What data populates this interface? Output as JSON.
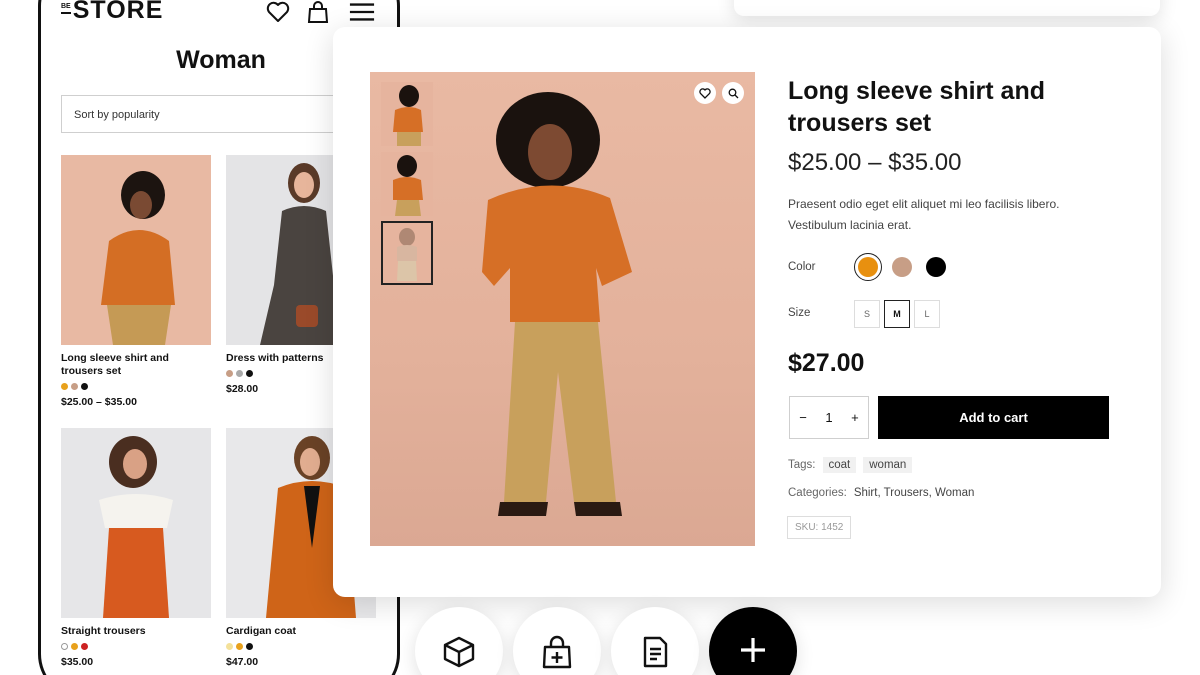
{
  "phone": {
    "logo_small": "BE",
    "logo_big": "STORE",
    "page_title": "Woman",
    "sort_label": "Sort by popularity",
    "products": [
      {
        "name": "Long sleeve shirt and trousers set",
        "price": "$25.00 – $35.00",
        "colors": [
          "#e8a11c",
          "#c79e86",
          "#111111"
        ]
      },
      {
        "name": "Dress with patterns",
        "price": "$28.00",
        "colors": [
          "#c79e86",
          "#aaaaaa",
          "#111111"
        ]
      },
      {
        "name": "Straight trousers",
        "price": "$35.00",
        "colors": [
          "#ffffff",
          "#e8a11c",
          "#cc2222"
        ]
      },
      {
        "name": "Cardigan coat",
        "price": "$47.00",
        "colors": [
          "#f4e19a",
          "#e8a11c",
          "#111111"
        ]
      }
    ]
  },
  "detail": {
    "title": "Long sleeve shirt and trousers set",
    "price_range": "$25.00 – $35.00",
    "description": "Praesent odio eget elit aliquet mi leo facilisis libero. Vestibulum lacinia erat.",
    "color_label": "Color",
    "colors": [
      "#e8900f",
      "#c79e86",
      "#000000"
    ],
    "selected_color_index": 0,
    "size_label": "Size",
    "sizes": [
      "S",
      "M",
      "L"
    ],
    "selected_size": "M",
    "sale_price": "$27.00",
    "quantity": "1",
    "qty_minus": "−",
    "qty_plus": "+",
    "add_to_cart": "Add to cart",
    "tags_label": "Tags:",
    "tags": [
      "coat",
      "woman"
    ],
    "categories_label": "Categories:",
    "categories": "Shirt, Trousers, Woman",
    "sku": "SKU: 1452"
  },
  "bottom_icons": [
    "box-icon",
    "bag-plus-icon",
    "document-icon",
    "plus-icon"
  ]
}
